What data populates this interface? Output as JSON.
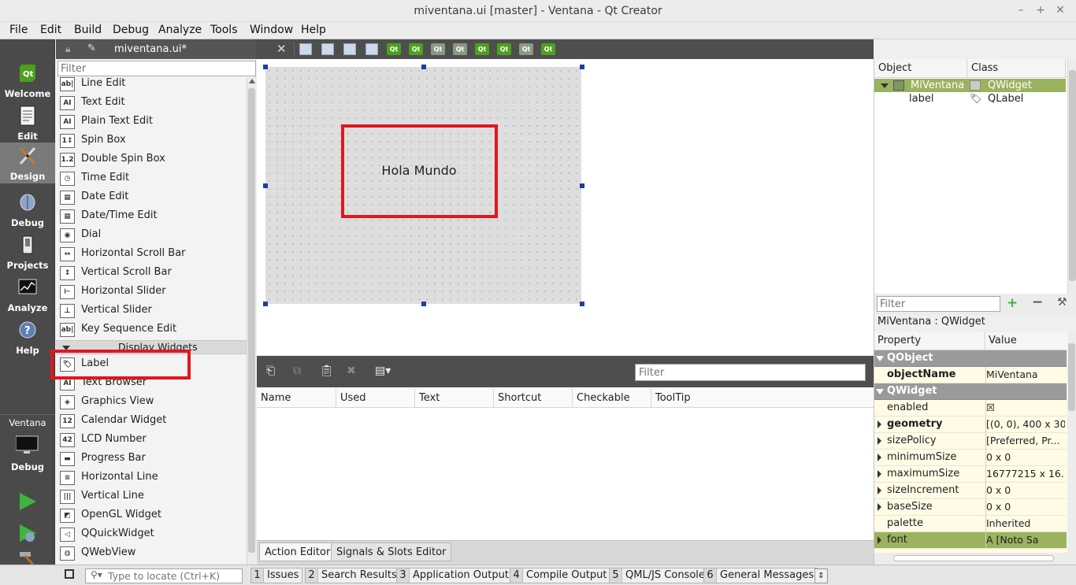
{
  "window": {
    "title": "miventana.ui [master] - Ventana - Qt Creator",
    "controls": [
      "–",
      "+",
      "✕"
    ]
  },
  "menu": [
    "File",
    "Edit",
    "Build",
    "Debug",
    "Analyze",
    "Tools",
    "Window",
    "Help"
  ],
  "modes": [
    {
      "label": "Welcome",
      "icon": "qt-logo-icon"
    },
    {
      "label": "Edit",
      "icon": "document-icon"
    },
    {
      "label": "Design",
      "icon": "design-pen-icon",
      "active": true
    },
    {
      "label": "Debug",
      "icon": "bug-icon"
    },
    {
      "label": "Projects",
      "icon": "wrench-icon"
    },
    {
      "label": "Analyze",
      "icon": "monitor-graph-icon"
    },
    {
      "label": "Help",
      "icon": "question-icon"
    }
  ],
  "kit": {
    "project": "Ventana",
    "config": "Debug"
  },
  "editor": {
    "file_name": "miventana.ui*"
  },
  "widget_box": {
    "filter_placeholder": "Filter",
    "items_top": [
      {
        "label": "Line Edit",
        "glyph": "ab|"
      },
      {
        "label": "Text Edit",
        "glyph": "AI"
      },
      {
        "label": "Plain Text Edit",
        "glyph": "AI"
      },
      {
        "label": "Spin Box",
        "glyph": "1↕"
      },
      {
        "label": "Double Spin Box",
        "glyph": "1.2"
      },
      {
        "label": "Time Edit",
        "glyph": "◷"
      },
      {
        "label": "Date Edit",
        "glyph": "▦"
      },
      {
        "label": "Date/Time Edit",
        "glyph": "▦"
      },
      {
        "label": "Dial",
        "glyph": "◉"
      },
      {
        "label": "Horizontal Scroll Bar",
        "glyph": "↔"
      },
      {
        "label": "Vertical Scroll Bar",
        "glyph": "↕"
      },
      {
        "label": "Horizontal Slider",
        "glyph": "⊢"
      },
      {
        "label": "Vertical Slider",
        "glyph": "⊥"
      },
      {
        "label": "Key Sequence Edit",
        "glyph": "ab|"
      }
    ],
    "category": "Display Widgets",
    "items_bottom": [
      {
        "label": "Label",
        "glyph": "🏷"
      },
      {
        "label": "Text Browser",
        "glyph": "AI"
      },
      {
        "label": "Graphics View",
        "glyph": "◈"
      },
      {
        "label": "Calendar Widget",
        "glyph": "12"
      },
      {
        "label": "LCD Number",
        "glyph": "42"
      },
      {
        "label": "Progress Bar",
        "glyph": "▬"
      },
      {
        "label": "Horizontal Line",
        "glyph": "≡"
      },
      {
        "label": "Vertical Line",
        "glyph": "|||"
      },
      {
        "label": "OpenGL Widget",
        "glyph": "◩"
      },
      {
        "label": "QQuickWidget",
        "glyph": "◁"
      },
      {
        "label": "QWebView",
        "glyph": "◍"
      }
    ]
  },
  "form": {
    "label_text": "Hola Mundo"
  },
  "action_editor": {
    "filter_placeholder": "Filter",
    "columns": [
      "Name",
      "Used",
      "Text",
      "Shortcut",
      "Checkable",
      "ToolTip"
    ],
    "tabs": [
      "Action Editor",
      "Signals & Slots Editor"
    ]
  },
  "object_inspector": {
    "columns": [
      "Object",
      "Class"
    ],
    "rows": [
      {
        "object": "MiVentana",
        "class": "QWidget",
        "selected": true
      },
      {
        "object": "label",
        "class": "QLabel",
        "selected": false
      }
    ]
  },
  "property_editor": {
    "filter_placeholder": "Filter",
    "class_label": "MiVentana : QWidget",
    "columns": [
      "Property",
      "Value"
    ],
    "rows": [
      {
        "kind": "group",
        "name": "QObject"
      },
      {
        "kind": "prop",
        "name": "objectName",
        "value": "MiVentana",
        "bold": true
      },
      {
        "kind": "group",
        "name": "QWidget"
      },
      {
        "kind": "prop",
        "name": "enabled",
        "value": "☒"
      },
      {
        "kind": "prop",
        "name": "geometry",
        "value": "[(0, 0), 400 x 30...",
        "bold": true,
        "expand": true
      },
      {
        "kind": "prop",
        "name": "sizePolicy",
        "value": "[Preferred, Pr...",
        "expand": true
      },
      {
        "kind": "prop",
        "name": "minimumSize",
        "value": "0 x 0",
        "expand": true
      },
      {
        "kind": "prop",
        "name": "maximumSize",
        "value": "16777215 x 16...",
        "expand": true
      },
      {
        "kind": "prop",
        "name": "sizeIncrement",
        "value": "0 x 0",
        "expand": true
      },
      {
        "kind": "prop",
        "name": "baseSize",
        "value": "0 x 0",
        "expand": true
      },
      {
        "kind": "prop",
        "name": "palette",
        "value": "Inherited"
      },
      {
        "kind": "prop",
        "name": "font",
        "value": "A [Noto Sa",
        "expand": true,
        "selected": true
      }
    ]
  },
  "statusbar": {
    "locator_placeholder": "Type to locate (Ctrl+K)",
    "panes": [
      {
        "num": "1",
        "label": "Issues"
      },
      {
        "num": "2",
        "label": "Search Results"
      },
      {
        "num": "3",
        "label": "Application Output"
      },
      {
        "num": "4",
        "label": "Compile Output"
      },
      {
        "num": "5",
        "label": "QML/JS Console"
      },
      {
        "num": "6",
        "label": "General Messages"
      }
    ]
  },
  "colors": {
    "highlight_red": "#e3161f",
    "selection_green": "#9bb25f",
    "qt_green": "#4ca11d"
  }
}
